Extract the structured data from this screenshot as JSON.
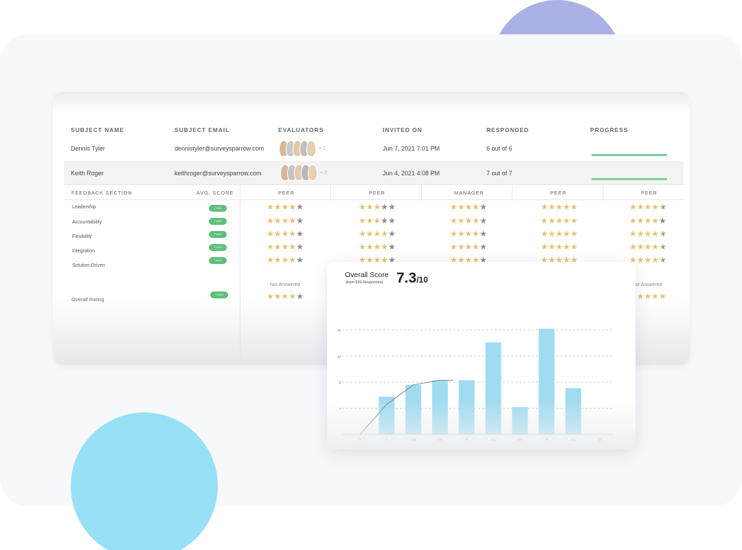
{
  "table": {
    "headers": [
      "SUBJECT NAME",
      "SUBJECT EMAIL",
      "EVALUATORS",
      "INVITED ON",
      "RESPONDED",
      "PROGRESS"
    ],
    "rows": [
      {
        "name": "Dennis Tyler",
        "email": "dennistyler@surveysparrow.com",
        "evaluators_more": "+ 1",
        "invited_on": "Jun 7, 2021 7:01 PM",
        "responded": "6 out of 6",
        "progress": 1.0
      },
      {
        "name": "Keith Roger",
        "email": "keithroger@surveysparrow.com",
        "evaluators_more": "+ 2",
        "invited_on": "Jun 4, 2021 4:08 PM",
        "responded": "7 out of 7",
        "progress": 1.0
      }
    ]
  },
  "feedback": {
    "section_header": "FEEDBACK SECTION",
    "avg_header": "AVG. SCORE",
    "columns": [
      "PEER",
      "PEER",
      "MANAGER",
      "PEER",
      "PEER"
    ],
    "metrics": [
      "Leadership",
      "Accountability",
      "Flexibility",
      "Integration",
      "Solution-Driven"
    ],
    "pill_scores": [
      "7.8/10",
      "7.8/10",
      "7.8/10",
      "7.2/10",
      "7.8/10"
    ],
    "ratings": [
      [
        4,
        3,
        4,
        5,
        4.5
      ],
      [
        4,
        3,
        4,
        5,
        4
      ],
      [
        4,
        4,
        4,
        5,
        4.5
      ],
      [
        4,
        4,
        4,
        5,
        4.5
      ],
      [
        4,
        4,
        4,
        5,
        4.5
      ]
    ],
    "not_answered": "Not Answered",
    "overall_label": "Overall Rating",
    "overall_pill": "7.3/10",
    "overall_ratings": [
      4,
      5
    ]
  },
  "score": {
    "title": "Overall Score",
    "subtitle": "(from 839 Responses)",
    "value": "7.3",
    "denominator": "/10"
  },
  "colors": {
    "bar": "#9fdcf2",
    "progress": "#7ccf9b",
    "star_on": "#e7c172",
    "star_off": "#8c8c8c",
    "pill": "#5fbf7c"
  },
  "chart_data": {
    "type": "bar",
    "categories": [
      "0",
      "1",
      "3.8",
      "3.8",
      "6",
      "6.1",
      "8.9",
      "9",
      "9.1",
      "10"
    ],
    "values": [
      0,
      5.8,
      7.6,
      8.3,
      8.3,
      14.1,
      4.2,
      16.2,
      7.1,
      0
    ],
    "yticks": [
      4,
      8,
      12,
      16
    ],
    "ylim": [
      0,
      16
    ],
    "grid": true,
    "cumulative_line": [
      [
        0,
        0
      ],
      [
        1,
        4.6
      ],
      [
        2,
        7.6
      ],
      [
        3,
        8.3
      ],
      [
        3.5,
        8.3
      ]
    ]
  }
}
